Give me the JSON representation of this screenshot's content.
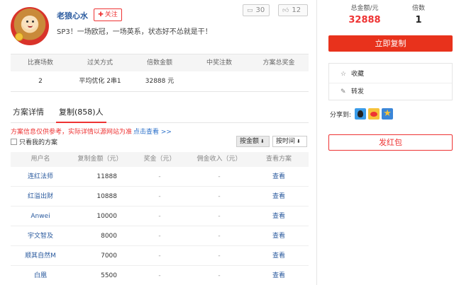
{
  "profile": {
    "username": "老狼心水",
    "follow_label": "关注",
    "motto": "SP3！一场欧冠，一场英系，状态好不怂就是干！",
    "comments_count": "30",
    "likes_count": "12"
  },
  "summary": {
    "headers": [
      "比赛场数",
      "过关方式",
      "倍数金额",
      "中奖注数",
      "方案总奖金"
    ],
    "values": [
      "2",
      "平均优化 2串1",
      "32888 元",
      "",
      ""
    ]
  },
  "tabs": {
    "detail": "方案详情",
    "copy": "复制(858)人"
  },
  "notice": {
    "warning": "方案信息仅供参考，实际详情以源网站为准",
    "link": "点击查看 >>"
  },
  "filter": {
    "only_mine": "只看我的方案",
    "sort_amount": "按金额",
    "sort_time": "按时间"
  },
  "copy_table": {
    "headers": [
      "用户名",
      "复制金额（元）",
      "奖金（元）",
      "佣金收入（元）",
      "查看方案"
    ],
    "rows": [
      {
        "user": "连红法师",
        "amount": "11888",
        "prize": "-",
        "commission": "-",
        "view": "查看"
      },
      {
        "user": "红溢出财",
        "amount": "10888",
        "prize": "-",
        "commission": "-",
        "view": "查看"
      },
      {
        "user": "Anwei",
        "amount": "10000",
        "prize": "-",
        "commission": "-",
        "view": "查看"
      },
      {
        "user": "宇文智及",
        "amount": "8000",
        "prize": "-",
        "commission": "-",
        "view": "查看"
      },
      {
        "user": "顺其自然M",
        "amount": "7000",
        "prize": "-",
        "commission": "-",
        "view": "查看"
      },
      {
        "user": "白凰",
        "amount": "5500",
        "prize": "-",
        "commission": "-",
        "view": "查看"
      }
    ]
  },
  "sidebar": {
    "total_label": "总金额/元",
    "total_value": "32888",
    "multiple_label": "倍数",
    "multiple_value": "1",
    "copy_now": "立即复制",
    "favorite": "收藏",
    "repost": "转发",
    "share_to": "分享到:",
    "red_packet": "发红包"
  },
  "colors": {
    "accent_red": "#e8321c",
    "link_blue": "#2a5a9e"
  }
}
